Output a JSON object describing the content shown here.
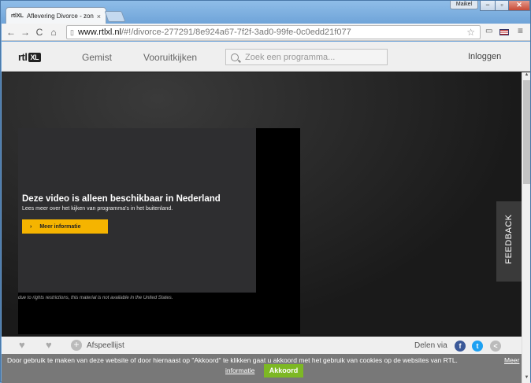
{
  "browser": {
    "tab_favicon": "rtlXL",
    "tab_title": "Aflevering Divorce - zondag",
    "tab_close": "×",
    "user": "Maikel",
    "window_min": "−",
    "window_max": "▫",
    "window_close": "✕",
    "nav_back": "←",
    "nav_forward": "→",
    "nav_reload": "C",
    "nav_home": "⌂",
    "url_host": "www.rtlxl.nl",
    "url_path": "/#!/divorce-277291/8e924a67-7f2f-3ad0-99fe-0c0edd21f077",
    "star": "☆",
    "menu": "≡"
  },
  "header": {
    "logo_rtl": "rtl",
    "logo_xl": "XL",
    "nav_gemist": "Gemist",
    "nav_vooruitkijken": "Vooruitkijken",
    "search_placeholder": "Zoek een programma...",
    "login": "Inloggen"
  },
  "player": {
    "title": "Deze video is alleen beschikbaar in Nederland",
    "subtitle": "Lees meer over het kijken van programma's in het buitenland.",
    "button_arrow": "›",
    "button_label": "Meer informatie",
    "rights_notice": "due to rights restrictions, this material is not available in the United States."
  },
  "feedback": "FEEDBACK",
  "actions": {
    "playlist": "Afspeellijst",
    "share": "Delen via",
    "facebook": "f",
    "twitter": "t",
    "share_other": "<"
  },
  "cookie": {
    "text": "Door gebruik te maken van deze website of door hiernaast op \"Akkoord\" te klikken gaat u akkoord met het gebruik van cookies op de websites van RTL.",
    "more_1": "Meer",
    "more_2": "informatie",
    "accept": "Akkoord"
  },
  "colors": {
    "accent_yellow": "#f5b400",
    "accept_green": "#7db824",
    "facebook": "#3b5998",
    "twitter": "#1da1f2"
  }
}
